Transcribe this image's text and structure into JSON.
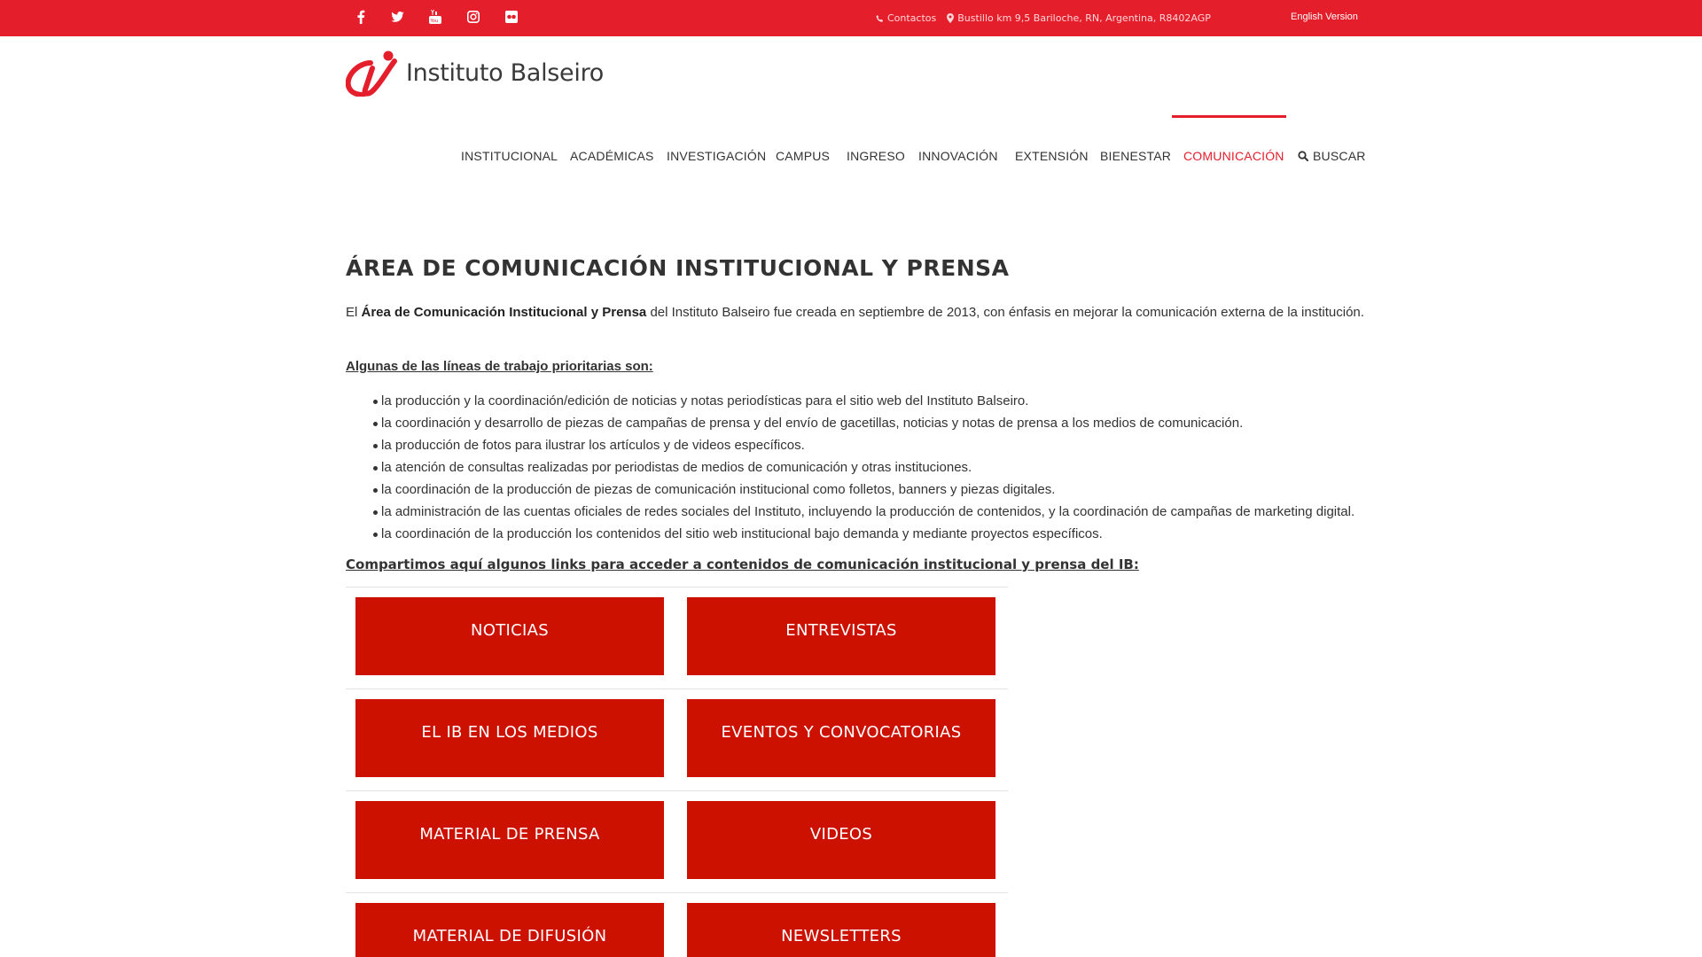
{
  "topbar": {
    "social": [
      {
        "name": "facebook-icon",
        "glyph": "f"
      },
      {
        "name": "twitter-icon",
        "glyph": "t"
      },
      {
        "name": "youtube-icon",
        "glyph": "You"
      },
      {
        "name": "instagram-icon",
        "glyph": "ig"
      },
      {
        "name": "flickr-icon",
        "glyph": "••"
      }
    ],
    "contact_label": "Contactos",
    "address": "Bustillo km 9,5  Bariloche, RN, Argentina, R8402AGP",
    "english_link": "English Version",
    "bg_color": "#e41e2b"
  },
  "logo": {
    "text": "Instituto Balseiro"
  },
  "nav": {
    "items": [
      {
        "label": "INSTITUCIONAL"
      },
      {
        "label": "ACADÉMICAS"
      },
      {
        "label": "INVESTIGACIÓN"
      },
      {
        "label": "CAMPUS"
      },
      {
        "label": "INGRESO"
      },
      {
        "label": "INNOVACIÓN"
      },
      {
        "label": "EXTENSIÓN"
      },
      {
        "label": "BIENESTAR"
      },
      {
        "label": "COMUNICACIÓN",
        "active": true
      },
      {
        "label": "BUSCAR"
      }
    ],
    "active_color": "#e41e2b"
  },
  "main": {
    "title": "ÁREA DE COMUNICACIÓN INSTITUCIONAL Y PRENSA",
    "intro_prefix": "El ",
    "intro_bold": "Área de Comunicación Institucional y Prensa",
    "intro_rest": " del Instituto Balseiro fue creada en septiembre de 2013, con énfasis en mejorar la comunicación externa de la institución.",
    "subhead1": "Algunas de las líneas de trabajo prioritarias son:",
    "bullets": [
      "la producción y la coordinación/edición de noticias y notas periodísticas para el sitio web del Instituto Balseiro.",
      "la coordinación y desarrollo de piezas de campañas de prensa y del envío de gacetillas, noticias y notas de prensa a los medios de comunicación.",
      "la producción de fotos para ilustrar los artículos y de videos específicos.",
      "la atención de consultas realizadas por periodistas de medios de comunicación y otras instituciones.",
      "la coordinación de la producción de piezas de comunicación institucional como folletos, banners y piezas digitales.",
      "la administración de las cuentas oficiales de redes sociales del Instituto, incluyendo la producción de contenidos, y la coordinación de campañas de marketing digital.",
      "la coordinación de la producción los contenidos del sitio web institucional bajo demanda y mediante proyectos específicos."
    ],
    "subhead2": "Compartimos aquí algunos links para acceder a contenidos de comunicación institucional y prensa del IB:",
    "buttons": [
      {
        "label": "NOTICIAS"
      },
      {
        "label": "ENTREVISTAS"
      },
      {
        "label": "EL IB EN LOS MEDIOS"
      },
      {
        "label": "EVENTOS Y CONVOCATORIAS"
      },
      {
        "label": "MATERIAL DE PRENSA"
      },
      {
        "label": "VIDEOS"
      },
      {
        "label": "MATERIAL DE DIFUSIÓN"
      },
      {
        "label": "NEWSLETTERS"
      }
    ],
    "button_color": "#cc1100"
  }
}
